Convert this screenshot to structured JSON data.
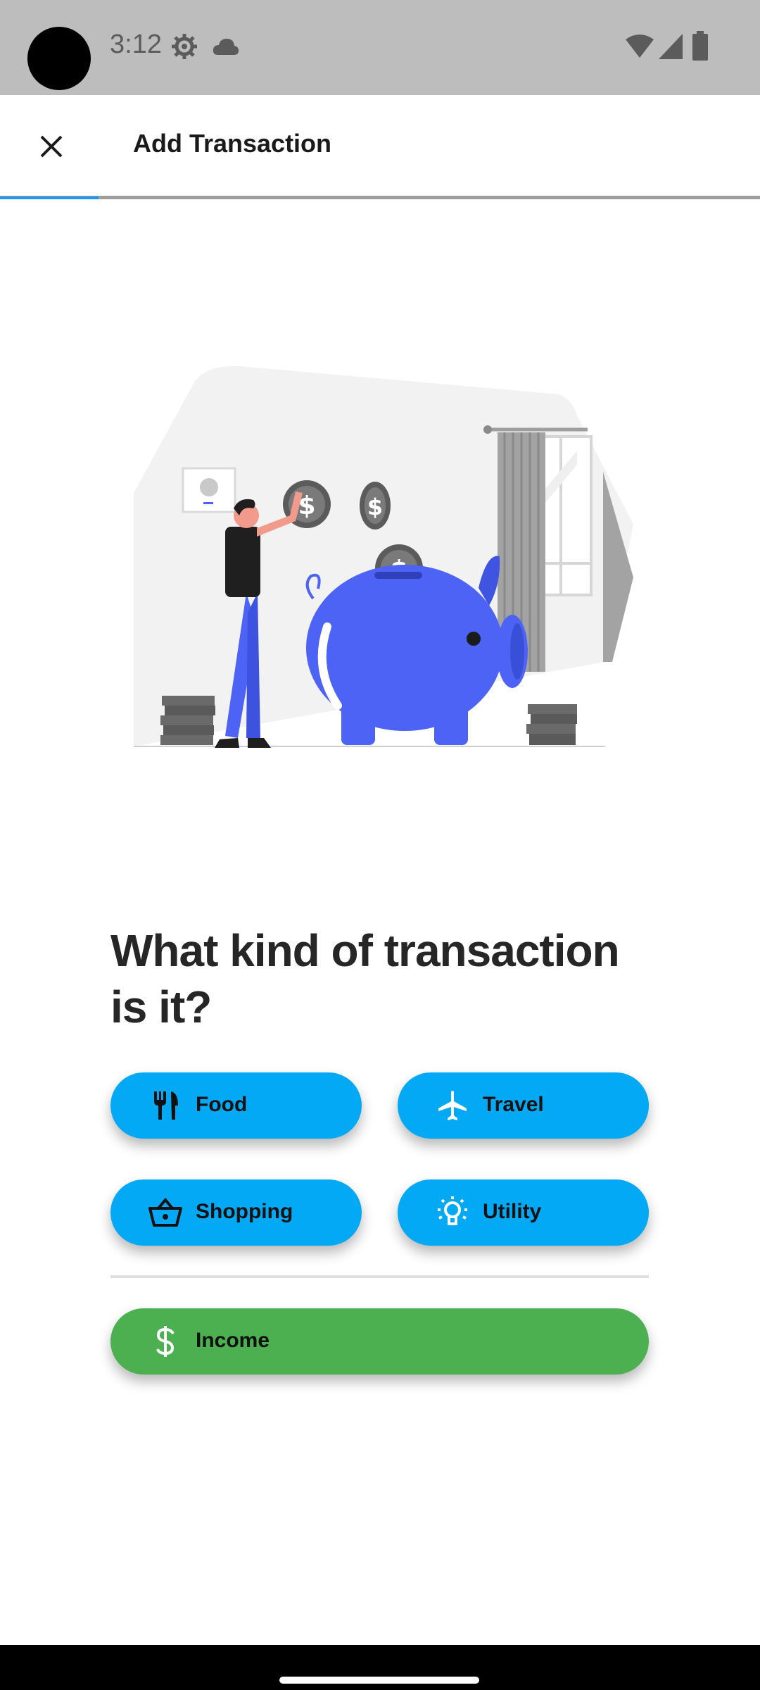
{
  "status_bar": {
    "time": "3:12",
    "icons": [
      "settings-gear-icon",
      "cloud-icon",
      "wifi-icon",
      "signal-icon",
      "battery-icon"
    ]
  },
  "app_bar": {
    "title": "Add Transaction",
    "close_icon": "close-icon",
    "progress": 0.13
  },
  "main": {
    "question": "What kind of transaction is it?",
    "categories": [
      {
        "label": "Food",
        "icon": "fork-knife-icon"
      },
      {
        "label": "Travel",
        "icon": "airplane-icon"
      },
      {
        "label": "Shopping",
        "icon": "basket-icon"
      },
      {
        "label": "Utility",
        "icon": "lightbulb-icon"
      }
    ],
    "income": {
      "label": "Income",
      "icon": "dollar-icon"
    }
  },
  "colors": {
    "category_button": "#03a9f4",
    "income_button": "#4caf50",
    "accent": "#2196f3",
    "piggy": "#4d63f5"
  }
}
